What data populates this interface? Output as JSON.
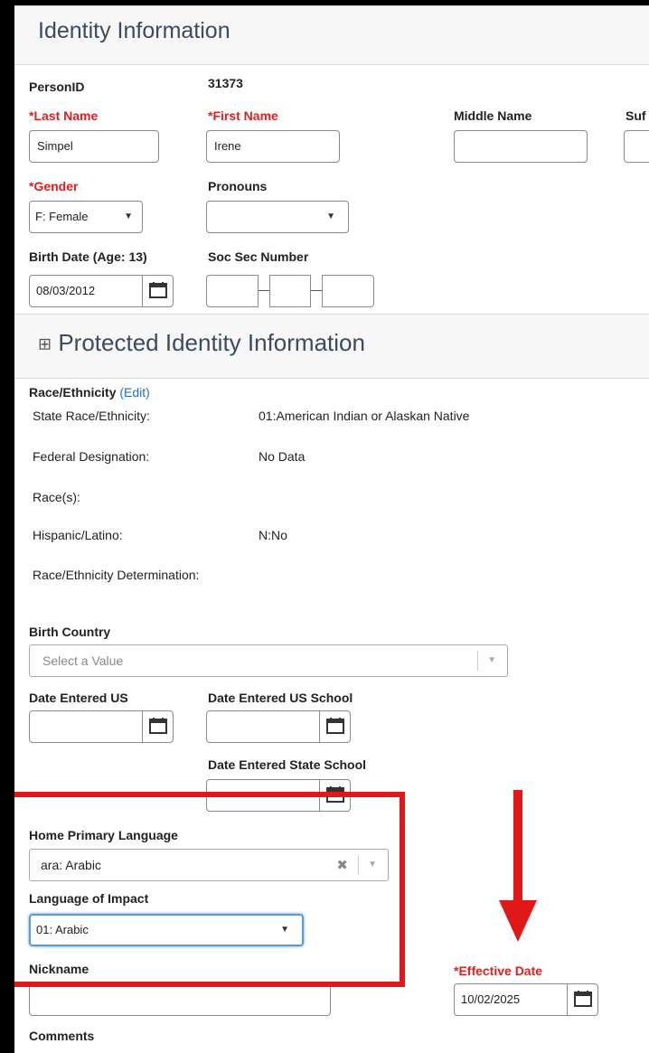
{
  "identity": {
    "section_title": "Identity Information",
    "person_id_label": "PersonID",
    "person_id_value": "31373",
    "last_name_label": "*Last Name",
    "last_name_value": "Simpel",
    "first_name_label": "*First Name",
    "first_name_value": "Irene",
    "middle_name_label": "Middle Name",
    "middle_name_value": "",
    "suffix_label": "Suf",
    "gender_label": "*Gender",
    "gender_value": "F: Female",
    "pronouns_label": "Pronouns",
    "pronouns_value": "",
    "birth_date_label": "Birth Date (Age: 13)",
    "birth_date_value": "08/03/2012",
    "ssn_label": "Soc Sec Number"
  },
  "protected": {
    "expand_symbol": "⊞",
    "section_title": "Protected Identity Information",
    "race_label": "Race/Ethnicity",
    "race_edit_link": "(Edit)",
    "state_race_label": "State Race/Ethnicity:",
    "state_race_value": "01:American Indian or Alaskan Native",
    "federal_label": "Federal Designation:",
    "federal_value": "No Data",
    "races_label": "Race(s):",
    "races_value": "",
    "hispanic_label": "Hispanic/Latino:",
    "hispanic_value": "N:No",
    "determination_label": "Race/Ethnicity Determination:"
  },
  "birth_country": {
    "label": "Birth Country",
    "placeholder": "Select a Value"
  },
  "dates": {
    "entered_us_label": "Date Entered US",
    "entered_us_school_label": "Date Entered US School",
    "entered_state_school_label": "Date Entered State School"
  },
  "language": {
    "home_primary_label": "Home Primary Language",
    "home_primary_value": "ara: Arabic",
    "impact_label": "Language of Impact",
    "impact_value": "01: Arabic"
  },
  "other": {
    "nickname_label": "Nickname",
    "effective_date_label": "*Effective Date",
    "effective_date_value": "10/02/2025",
    "comments_label": "Comments"
  },
  "colors": {
    "required": "#e02020",
    "annotation": "#e01818",
    "link": "#2a6ebb"
  },
  "icons": [
    "calendar-icon",
    "caret-down-icon",
    "clear-x-icon",
    "expand-plus-icon",
    "annotation-arrow"
  ]
}
